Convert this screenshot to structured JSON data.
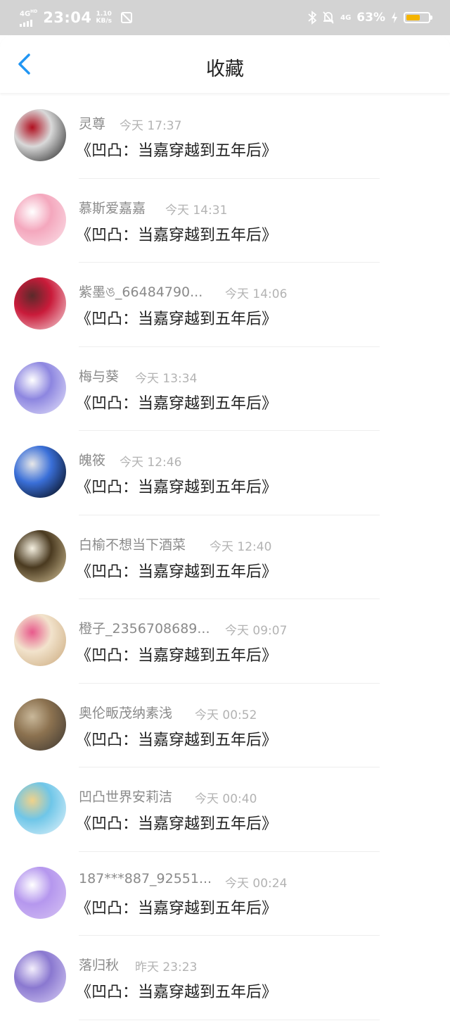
{
  "status_bar": {
    "network": "4G",
    "network_sup": "HD",
    "time": "23:04",
    "speed_value": "1.10",
    "speed_unit": "KB/s",
    "network_right": "4G",
    "battery": "63%",
    "battery_level": 0.63,
    "battery_color": "#f4b400"
  },
  "header": {
    "title": "收藏",
    "back_icon": "chevron-left-icon",
    "back_color": "#2196f3"
  },
  "favorites": [
    {
      "user": "灵尊",
      "time": "今天 17:37",
      "book": "《凹凸：当嘉穿越到五年后》",
      "avatar_colors": [
        "#1a1a1a",
        "#d9d9d9",
        "#b01020"
      ]
    },
    {
      "user": "慕斯爱嘉嘉",
      "time": "今天 14:31",
      "book": "《凹凸：当嘉穿越到五年后》",
      "avatar_colors": [
        "#fbe3ea",
        "#f4a7bd",
        "#ffffff"
      ]
    },
    {
      "user": "紫墨ঙ_66484790...",
      "time": "今天 14:06",
      "book": "《凹凸：当嘉穿越到五年后》",
      "avatar_colors": [
        "#f6d8dc",
        "#c91b3a",
        "#5a2a2a"
      ]
    },
    {
      "user": "梅与葵",
      "time": "今天 13:34",
      "book": "《凹凸：当嘉穿越到五年后》",
      "avatar_colors": [
        "#e8e6fb",
        "#8d86e0",
        "#ffffff"
      ]
    },
    {
      "user": "魄筱",
      "time": "今天 12:46",
      "book": "《凹凸：当嘉穿越到五年后》",
      "avatar_colors": [
        "#000000",
        "#3a6fd8",
        "#e8e8e8"
      ]
    },
    {
      "user": "白榆不想当下酒菜",
      "time": "今天 12:40",
      "book": "《凹凸：当嘉穿越到五年后》",
      "avatar_colors": [
        "#d9c79c",
        "#4a3a20",
        "#f5f0e0"
      ]
    },
    {
      "user": "橙子_2356708689...",
      "time": "今天 09:07",
      "book": "《凹凸：当嘉穿越到五年后》",
      "avatar_colors": [
        "#c9a77a",
        "#f2e3cc",
        "#e85a8c"
      ]
    },
    {
      "user": "奥伦畈茂纳素浅",
      "time": "今天 00:52",
      "book": "《凹凸：当嘉穿越到五年后》",
      "avatar_colors": [
        "#3a3530",
        "#8c7250",
        "#c9b89a"
      ]
    },
    {
      "user": "凹凸世界安莉洁",
      "time": "今天 00:40",
      "book": "《凹凸：当嘉穿越到五年后》",
      "avatar_colors": [
        "#e6f4fb",
        "#6fc6e8",
        "#f0d28a"
      ]
    },
    {
      "user": "187***887_92551...",
      "time": "今天 00:24",
      "book": "《凹凸：当嘉穿越到五年后》",
      "avatar_colors": [
        "#d7c4f3",
        "#b597ee",
        "#ffffff"
      ]
    },
    {
      "user": "落归秋",
      "time": "昨天 23:23",
      "book": "《凹凸：当嘉穿越到五年后》",
      "avatar_colors": [
        "#d9d0f5",
        "#8a78d0",
        "#f3eefc"
      ]
    }
  ]
}
